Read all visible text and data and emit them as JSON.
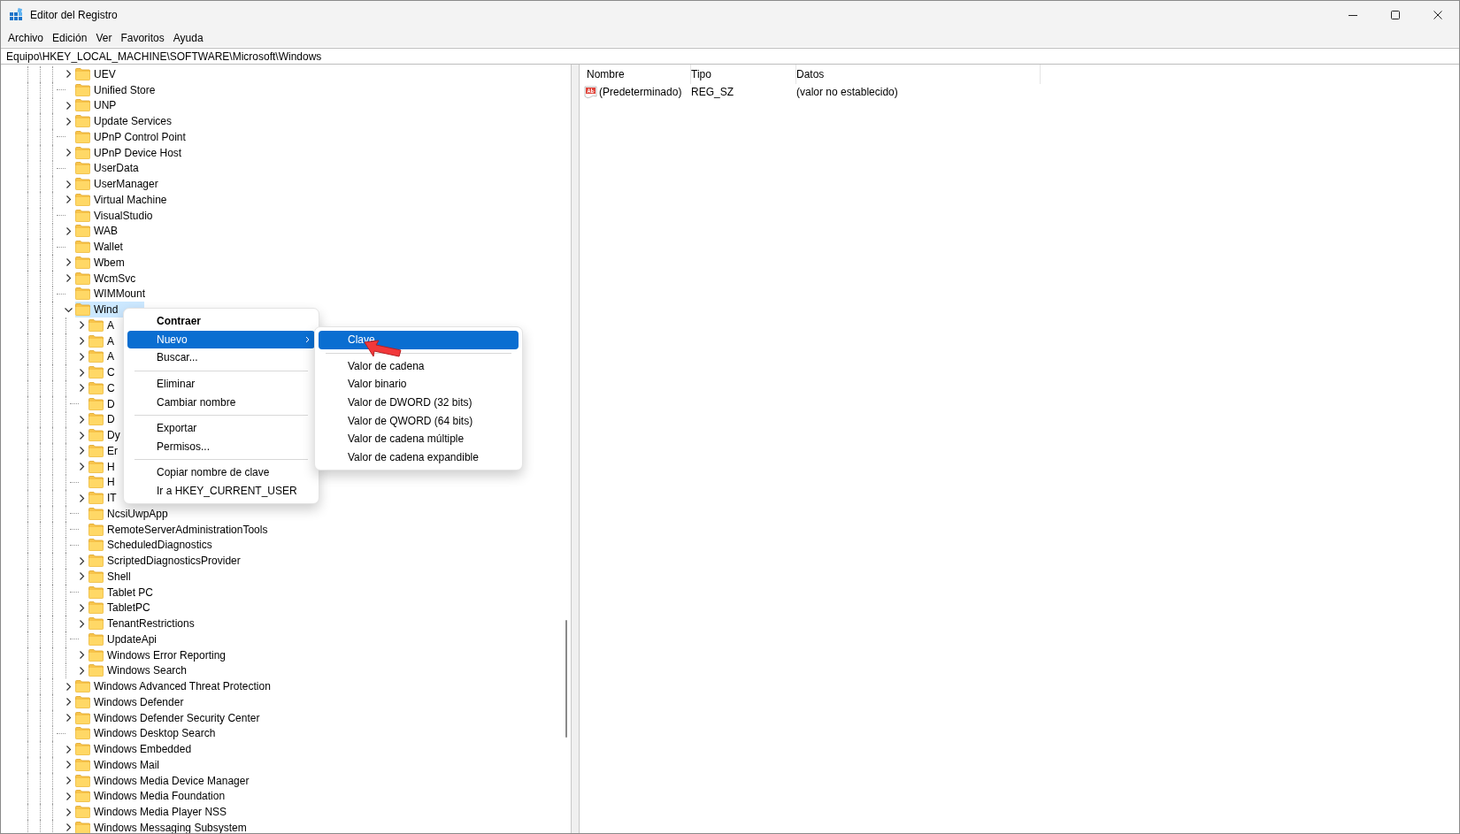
{
  "window": {
    "title": "Editor del Registro"
  },
  "menu_bar": [
    "Archivo",
    "Edición",
    "Ver",
    "Favoritos",
    "Ayuda"
  ],
  "address": "Equipo\\HKEY_LOCAL_MACHINE\\SOFTWARE\\Microsoft\\Windows",
  "tree": {
    "items": [
      {
        "label": "UEV",
        "kind": "key",
        "expanded": false,
        "selected": false
      },
      {
        "label": "Unified Store",
        "kind": "leaf",
        "selected": false
      },
      {
        "label": "UNP",
        "kind": "key",
        "expanded": false,
        "selected": false
      },
      {
        "label": "Update Services",
        "kind": "key",
        "expanded": false,
        "selected": false
      },
      {
        "label": "UPnP Control Point",
        "kind": "leaf",
        "selected": false
      },
      {
        "label": "UPnP Device Host",
        "kind": "key",
        "expanded": false,
        "selected": false
      },
      {
        "label": "UserData",
        "kind": "leaf",
        "selected": false
      },
      {
        "label": "UserManager",
        "kind": "key",
        "expanded": false,
        "selected": false
      },
      {
        "label": "Virtual Machine",
        "kind": "key",
        "expanded": false,
        "selected": false
      },
      {
        "label": "VisualStudio",
        "kind": "leaf",
        "selected": false
      },
      {
        "label": "WAB",
        "kind": "key",
        "expanded": false,
        "selected": false
      },
      {
        "label": "Wallet",
        "kind": "leaf",
        "selected": false
      },
      {
        "label": "Wbem",
        "kind": "key",
        "expanded": false,
        "selected": false
      },
      {
        "label": "WcmSvc",
        "kind": "key",
        "expanded": false,
        "selected": false
      },
      {
        "label": "WIMMount",
        "kind": "leaf",
        "selected": false
      },
      {
        "label": "Wind",
        "kind": "key",
        "expanded": true,
        "selected": true,
        "children": [
          {
            "label": "A",
            "kind": "key",
            "expanded": false,
            "selected": false
          },
          {
            "label": "A",
            "kind": "key",
            "expanded": false,
            "selected": false
          },
          {
            "label": "A",
            "kind": "key",
            "expanded": false,
            "selected": false
          },
          {
            "label": "C",
            "kind": "key",
            "expanded": false,
            "selected": false
          },
          {
            "label": "C",
            "kind": "key",
            "expanded": false,
            "selected": false
          },
          {
            "label": "D",
            "kind": "leaf",
            "selected": false
          },
          {
            "label": "D",
            "kind": "key",
            "expanded": false,
            "selected": false
          },
          {
            "label": "Dy",
            "kind": "key",
            "expanded": false,
            "selected": false
          },
          {
            "label": "Er",
            "kind": "key",
            "expanded": false,
            "selected": false
          },
          {
            "label": "H",
            "kind": "key",
            "expanded": false,
            "selected": false
          },
          {
            "label": "H",
            "kind": "leaf",
            "selected": false
          },
          {
            "label": "IT",
            "kind": "key",
            "expanded": false,
            "selected": false
          },
          {
            "label": "NcsiUwpApp",
            "kind": "leaf",
            "selected": false
          },
          {
            "label": "RemoteServerAdministrationTools",
            "kind": "leaf",
            "selected": false
          },
          {
            "label": "ScheduledDiagnostics",
            "kind": "leaf",
            "selected": false
          },
          {
            "label": "ScriptedDiagnosticsProvider",
            "kind": "key",
            "expanded": false,
            "selected": false
          },
          {
            "label": "Shell",
            "kind": "key",
            "expanded": false,
            "selected": false
          },
          {
            "label": "Tablet PC",
            "kind": "leaf",
            "selected": false
          },
          {
            "label": "TabletPC",
            "kind": "key",
            "expanded": false,
            "selected": false
          },
          {
            "label": "TenantRestrictions",
            "kind": "key",
            "expanded": false,
            "selected": false
          },
          {
            "label": "UpdateApi",
            "kind": "leaf",
            "selected": false
          },
          {
            "label": "Windows Error Reporting",
            "kind": "key",
            "expanded": false,
            "selected": false
          },
          {
            "label": "Windows Search",
            "kind": "key",
            "expanded": false,
            "selected": false
          }
        ]
      },
      {
        "label": "Windows Advanced Threat Protection",
        "kind": "key",
        "expanded": false,
        "selected": false
      },
      {
        "label": "Windows Defender",
        "kind": "key",
        "expanded": false,
        "selected": false
      },
      {
        "label": "Windows Defender Security Center",
        "kind": "key",
        "expanded": false,
        "selected": false
      },
      {
        "label": "Windows Desktop Search",
        "kind": "leaf",
        "selected": false
      },
      {
        "label": "Windows Embedded",
        "kind": "key",
        "expanded": false,
        "selected": false
      },
      {
        "label": "Windows Mail",
        "kind": "key",
        "expanded": false,
        "selected": false
      },
      {
        "label": "Windows Media Device Manager",
        "kind": "key",
        "expanded": false,
        "selected": false
      },
      {
        "label": "Windows Media Foundation",
        "kind": "key",
        "expanded": false,
        "selected": false
      },
      {
        "label": "Windows Media Player NSS",
        "kind": "key",
        "expanded": false,
        "selected": false
      },
      {
        "label": "Windows Messaging Subsystem",
        "kind": "key",
        "expanded": false,
        "selected": false
      }
    ]
  },
  "values_table": {
    "columns": [
      "Nombre",
      "Tipo",
      "Datos"
    ],
    "rows": [
      {
        "name": "(Predeterminado)",
        "type": "REG_SZ",
        "data": "(valor no establecido)"
      }
    ]
  },
  "context_menu": {
    "items": [
      {
        "kind": "item",
        "label": "Contraer",
        "default": true,
        "submenu": false,
        "selected": false
      },
      {
        "kind": "item",
        "label": "Nuevo",
        "default": false,
        "submenu": true,
        "selected": true
      },
      {
        "kind": "item",
        "label": "Buscar...",
        "default": false,
        "submenu": false,
        "selected": false
      },
      {
        "kind": "separator"
      },
      {
        "kind": "item",
        "label": "Eliminar",
        "default": false,
        "submenu": false,
        "selected": false
      },
      {
        "kind": "item",
        "label": "Cambiar nombre",
        "default": false,
        "submenu": false,
        "selected": false
      },
      {
        "kind": "separator"
      },
      {
        "kind": "item",
        "label": "Exportar",
        "default": false,
        "submenu": false,
        "selected": false
      },
      {
        "kind": "item",
        "label": "Permisos...",
        "default": false,
        "submenu": false,
        "selected": false
      },
      {
        "kind": "separator"
      },
      {
        "kind": "item",
        "label": "Copiar nombre de clave",
        "default": false,
        "submenu": false,
        "selected": false
      },
      {
        "kind": "item",
        "label": "Ir a HKEY_CURRENT_USER",
        "default": false,
        "submenu": false,
        "selected": false
      }
    ]
  },
  "submenu": {
    "items": [
      {
        "kind": "item",
        "label": "Clave",
        "default": false,
        "submenu": false,
        "selected": true
      },
      {
        "kind": "separator"
      },
      {
        "kind": "item",
        "label": "Valor de cadena",
        "default": false,
        "submenu": false,
        "selected": false
      },
      {
        "kind": "item",
        "label": "Valor binario",
        "default": false,
        "submenu": false,
        "selected": false
      },
      {
        "kind": "item",
        "label": "Valor de DWORD (32 bits)",
        "default": false,
        "submenu": false,
        "selected": false
      },
      {
        "kind": "item",
        "label": "Valor de QWORD (64 bits)",
        "default": false,
        "submenu": false,
        "selected": false
      },
      {
        "kind": "item",
        "label": "Valor de cadena múltiple",
        "default": false,
        "submenu": false,
        "selected": false
      },
      {
        "kind": "item",
        "label": "Valor de cadena expandible",
        "default": false,
        "submenu": false,
        "selected": false
      }
    ]
  }
}
